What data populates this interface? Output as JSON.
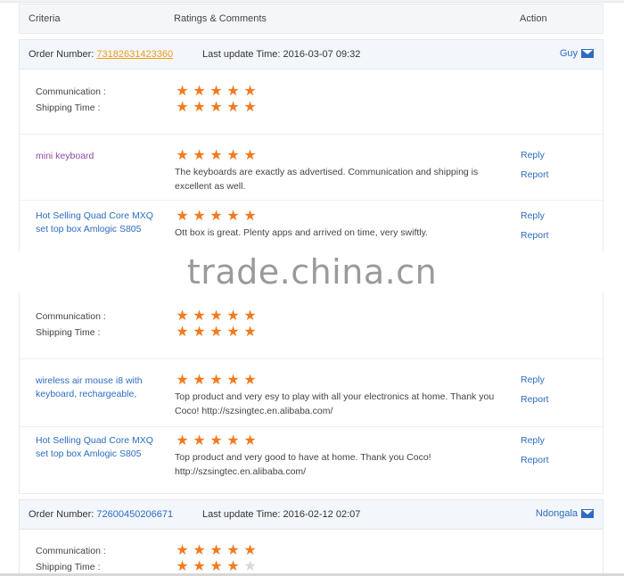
{
  "header": {
    "criteria": "Criteria",
    "ratings": "Ratings & Comments",
    "action": "Action"
  },
  "orders": [
    {
      "order_label": "Order Number:",
      "order_number": "73182631423360",
      "update_label": "Last update Time:",
      "update_time": "2016-03-07 09:32",
      "buyer": "Guy",
      "criteria": [
        {
          "label": "Communication :",
          "stars": 5
        },
        {
          "label": "Shipping Time :",
          "stars": 5
        }
      ],
      "products": [
        {
          "name": "mini keyboard",
          "stars": 5,
          "comment": "The keyboards are exactly as advertised. Communication and shipping is excellent as well.",
          "reply": "Reply",
          "report": "Report"
        },
        {
          "name": "Hot Selling Quad Core MXQ set top box Amlogic S805",
          "stars": 5,
          "comment": "Ott box is great. Plenty apps and arrived on time, very swiftly.",
          "reply": "Reply",
          "report": "Report"
        }
      ]
    },
    {
      "criteria": [
        {
          "label": "Communication :",
          "stars": 5
        },
        {
          "label": "Shipping Time :",
          "stars": 5
        }
      ],
      "products": [
        {
          "name": "wireless air mouse i8 with keyboard, rechargeable,",
          "stars": 5,
          "comment": "Top product and very esy to play with all your electronics at home. Thank you Coco! http://szsingtec.en.alibaba.com/",
          "reply": "Reply",
          "report": "Report"
        },
        {
          "name": "Hot Selling Quad Core MXQ set top box Amlogic S805",
          "stars": 5,
          "comment": "Top product and very good to have at home. Thank you Coco! http://szsingtec.en.alibaba.com/",
          "reply": "Reply",
          "report": "Report"
        }
      ]
    },
    {
      "order_label": "Order Number:",
      "order_number": "72600450206671",
      "update_label": "Last update Time:",
      "update_time": "2016-02-12 02:07",
      "buyer": "Ndongala",
      "criteria": [
        {
          "label": "Communication :",
          "stars": 5
        },
        {
          "label": "Shipping Time :",
          "stars": 4
        }
      ]
    }
  ],
  "watermark": "trade.china.cn",
  "colors": {
    "star": "#f37a21",
    "link": "#2d6cc0",
    "order_link": "#f29b1d",
    "visited": "#8e4aa5"
  }
}
